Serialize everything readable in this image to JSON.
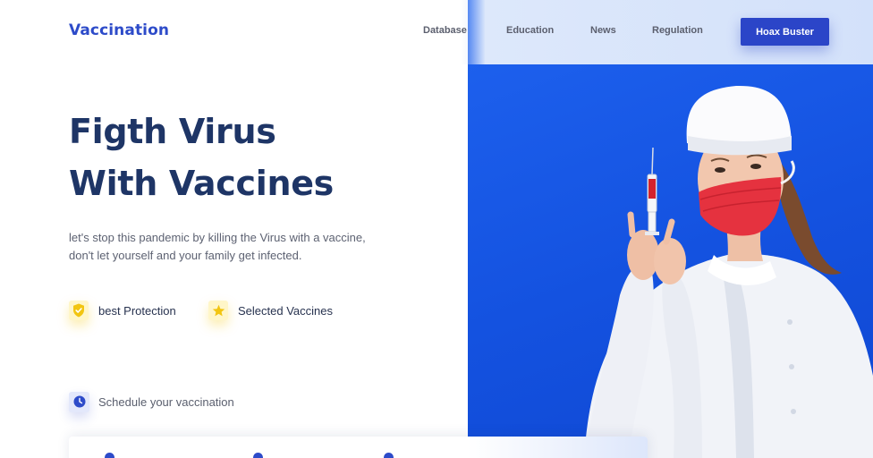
{
  "header": {
    "logo": "Vaccination",
    "nav": [
      "Database",
      "Education",
      "News",
      "Regulation"
    ],
    "cta": "Hoax Buster"
  },
  "hero": {
    "title_line1": "Figth Virus",
    "title_line2": "With Vaccines",
    "subtitle_line1": "let's stop this pandemic by killing the Virus with a vaccine,",
    "subtitle_line2": "don't let yourself and your family get infected.",
    "image_description_icon": "nurse-with-syringe-image"
  },
  "features": [
    {
      "label": "best Protection",
      "icon": "shield-check-icon"
    },
    {
      "label": "Selected Vaccines",
      "icon": "star-icon"
    }
  ],
  "schedule": {
    "label": "Schedule your vaccination",
    "icon": "clock-icon"
  },
  "colors": {
    "brand": "#2d4bc9",
    "heading": "#1e3566",
    "hero_background": "#1a5ae8",
    "feature_accent": "#f5cd28"
  }
}
